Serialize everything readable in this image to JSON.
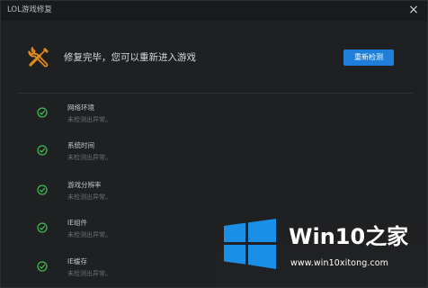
{
  "window": {
    "title": "LOL游戏修复",
    "close_glyph": "×"
  },
  "header": {
    "icon": "wrench-screwdriver-icon",
    "status_text": "修复完毕，您可以重新进入游戏",
    "recheck_label": "重新检测",
    "accent_color": "#e08a1e",
    "button_color": "#1e7ed8"
  },
  "checks": [
    {
      "name": "网络环境",
      "result": "未检测出异常。"
    },
    {
      "name": "系统时间",
      "result": "未检测出异常。"
    },
    {
      "name": "游戏分辨率",
      "result": "未检测出异常。"
    },
    {
      "name": "IE组件",
      "result": "未检测出异常。"
    },
    {
      "name": "IE缓存",
      "result": "未检测出异常。"
    }
  ],
  "check_icon": "check-circle-icon",
  "check_color": "#3fb950",
  "watermark": {
    "title": "Win10",
    "title_suffix": "之家",
    "url": "www.win10xitong.com"
  }
}
